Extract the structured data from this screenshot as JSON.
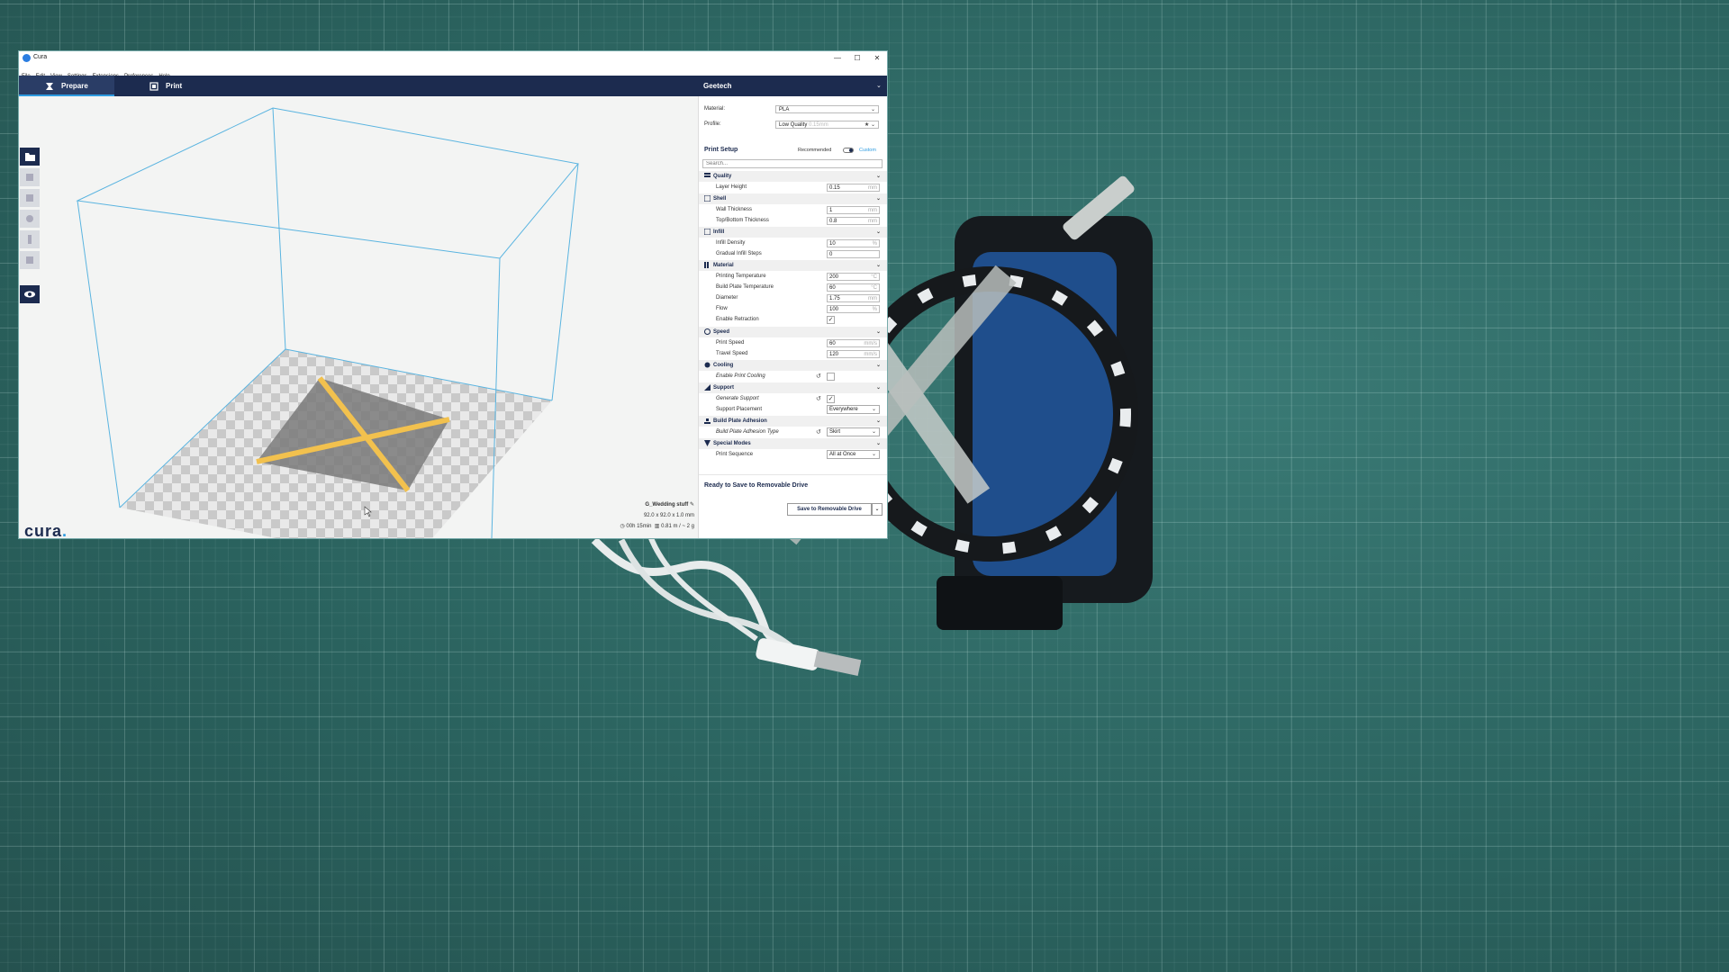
{
  "window": {
    "title": "Cura",
    "minimize": "—",
    "maximize": "☐",
    "close": "✕"
  },
  "menu": [
    "File",
    "Edit",
    "View",
    "Settings",
    "Extensions",
    "Preferences",
    "Help"
  ],
  "tabs": {
    "prepare": "Prepare",
    "print": "Print"
  },
  "printer": "Geetech",
  "material": {
    "label": "Material:",
    "value": "PLA"
  },
  "profile": {
    "label": "Profile:",
    "value": "Low Quality",
    "hint": "0.15mm"
  },
  "print_setup": {
    "title": "Print Setup",
    "recommended": "Recommended",
    "custom": "Custom",
    "search_placeholder": "Search..."
  },
  "categories": {
    "quality": "Quality",
    "shell": "Shell",
    "infill": "Infill",
    "material": "Material",
    "speed": "Speed",
    "cooling": "Cooling",
    "support": "Support",
    "adhesion": "Build Plate Adhesion",
    "special": "Special Modes"
  },
  "settings": {
    "layer_height": {
      "label": "Layer Height",
      "value": "0.15",
      "unit": "mm"
    },
    "wall_thickness": {
      "label": "Wall Thickness",
      "value": "1",
      "unit": "mm"
    },
    "top_bottom": {
      "label": "Top/Bottom Thickness",
      "value": "0.8",
      "unit": "mm"
    },
    "infill_density": {
      "label": "Infill Density",
      "value": "10",
      "unit": "%"
    },
    "gradual_infill": {
      "label": "Gradual Infill Steps",
      "value": "0",
      "unit": ""
    },
    "print_temp": {
      "label": "Printing Temperature",
      "value": "200",
      "unit": "°C"
    },
    "plate_temp": {
      "label": "Build Plate Temperature",
      "value": "60",
      "unit": "°C"
    },
    "diameter": {
      "label": "Diameter",
      "value": "1.75",
      "unit": "mm"
    },
    "flow": {
      "label": "Flow",
      "value": "100",
      "unit": "%"
    },
    "retraction": {
      "label": "Enable Retraction",
      "check": "✓"
    },
    "print_speed": {
      "label": "Print Speed",
      "value": "60",
      "unit": "mm/s"
    },
    "travel_speed": {
      "label": "Travel Speed",
      "value": "120",
      "unit": "mm/s"
    },
    "print_cooling": {
      "label": "Enable Print Cooling",
      "check": ""
    },
    "gen_support": {
      "label": "Generate Support",
      "check": "✓"
    },
    "support_placement": {
      "label": "Support Placement",
      "value": "Everywhere"
    },
    "adhesion_type": {
      "label": "Build Plate Adhesion Type",
      "value": "Skirt"
    },
    "print_sequence": {
      "label": "Print Sequence",
      "value": "All at Once"
    }
  },
  "status": {
    "ready": "Ready to Save to Removable Drive",
    "save_button": "Save to Removable Drive"
  },
  "job": {
    "name": "G_Wedding stuff",
    "dims": "92.0 x 92.0 x 1.0 mm",
    "time": "00h 15min",
    "material": "0.81 m / ~ 2 g"
  },
  "logo": {
    "text": "cura",
    "dot": "."
  },
  "colors": {
    "accent": "#2d9be0",
    "header": "#1c2b4f",
    "model": "#f2c14e"
  }
}
